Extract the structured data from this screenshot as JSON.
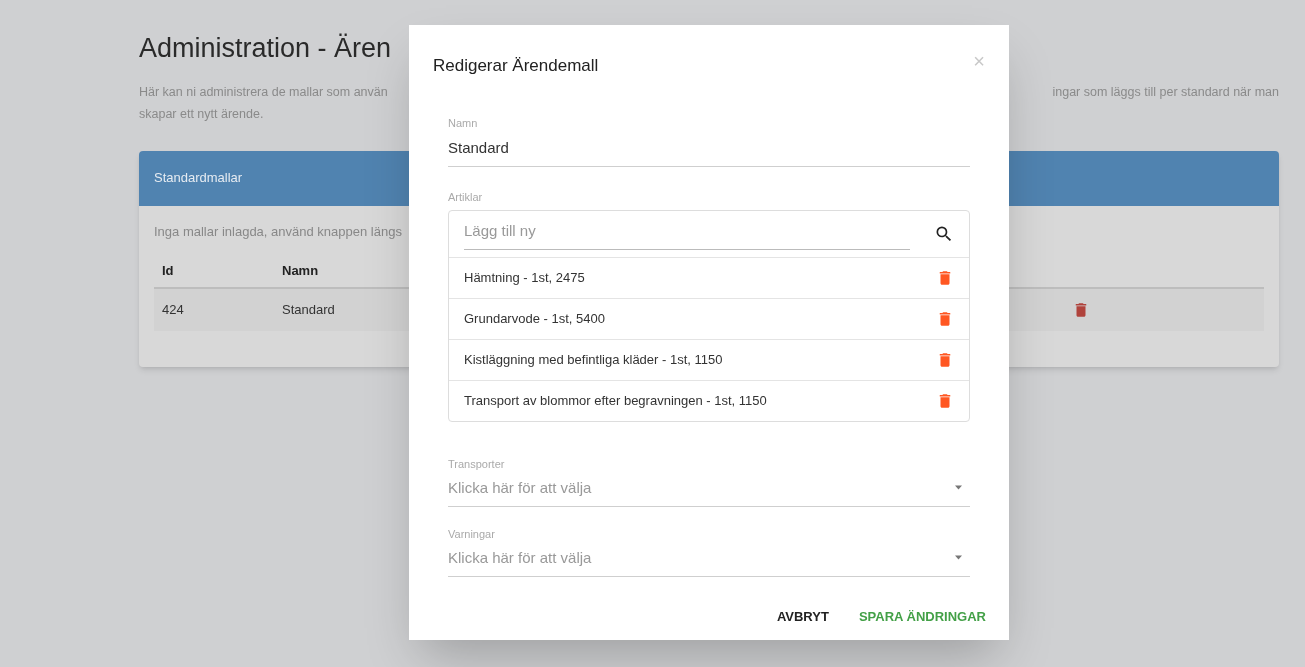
{
  "page": {
    "title": "Administration - Ären",
    "description_left": "Här kan ni administrera de mallar som använ",
    "description_right": "ingar som läggs till per standard när man",
    "description_line2": "skapar ett nytt ärende."
  },
  "card": {
    "title": "Standardmallar",
    "empty_text": "Inga mallar inlagda, använd knappen längs",
    "columns": [
      "Id",
      "Namn"
    ],
    "rows": [
      {
        "id": "424",
        "name": "Standard"
      }
    ]
  },
  "dialog": {
    "title": "Redigerar Ärendemall",
    "close": "×",
    "name_field": {
      "label": "Namn",
      "value": "Standard"
    },
    "articles": {
      "label": "Artiklar",
      "placeholder": "Lägg till ny",
      "items": [
        "Hämtning - 1st, 2475",
        "Grundarvode - 1st, 5400",
        "Kistläggning med befintliga kläder - 1st, 1150",
        "Transport av blommor efter begravningen - 1st, 1150"
      ]
    },
    "selects": [
      {
        "label": "Transporter",
        "placeholder": "Klicka här för att välja"
      },
      {
        "label": "Varningar",
        "placeholder": "Klicka här för att välja"
      }
    ],
    "buttons": [
      {
        "label": "AVBRYT",
        "kind": "cancel"
      },
      {
        "label": "SPARA ÄNDRINGAR",
        "kind": "primary"
      }
    ]
  }
}
